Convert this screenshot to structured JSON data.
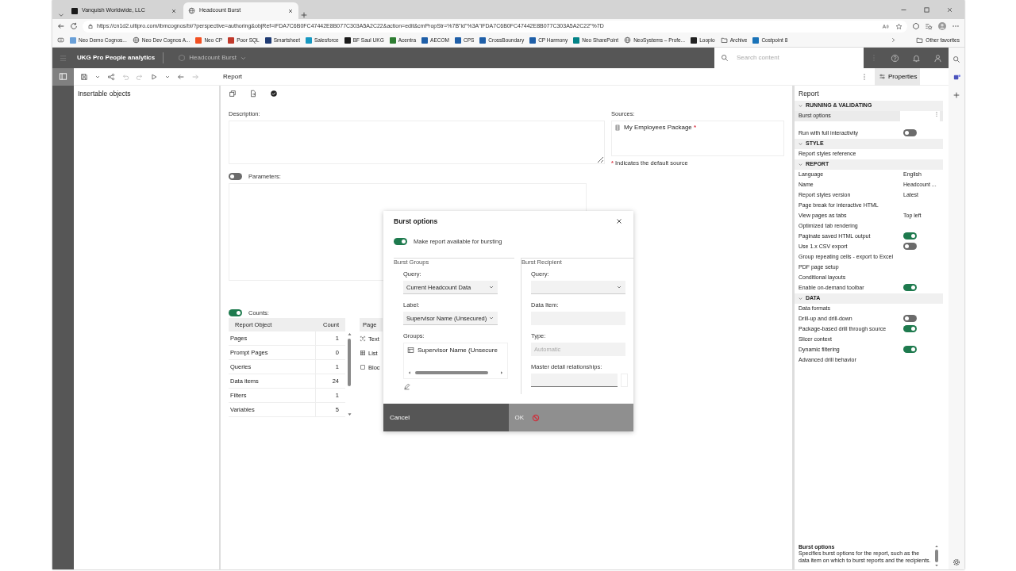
{
  "browser": {
    "tabs": [
      {
        "label": "Vanquish Worldwide, LLC",
        "kind": "tile",
        "color": "#1a1a1a",
        "selected": false
      },
      {
        "label": "Headcount Burst",
        "kind": "globe",
        "selected": true
      }
    ],
    "url": "https://cn1d2.ultipro.com/ibmcognos/bi/?perspective=authoring&objRef=iFDA7C6B0FC47442E8B077C303A5A2C22&action=edit&cmPropStr=%7B\"id\"%3A\"iFDA7C6B0FC47442E8B077C303A5A2C22\"%7D",
    "bookmarks": [
      {
        "label": "Neo Demo Cognos...",
        "kind": "tile",
        "color": "#6aa0d8"
      },
      {
        "label": "Neo Dev Cognos A...",
        "kind": "globe"
      },
      {
        "label": "Neo CP",
        "kind": "tile",
        "color": "#f25022"
      },
      {
        "label": "Poor SQL",
        "kind": "tile",
        "color": "#c0392b"
      },
      {
        "label": "Smartsheet",
        "kind": "tile",
        "color": "#1f3b73"
      },
      {
        "label": "Salesforce",
        "kind": "tile",
        "color": "#1798c1"
      },
      {
        "label": "BF Saul UKG",
        "kind": "tile",
        "color": "#1a1a1a"
      },
      {
        "label": "Acentra",
        "kind": "tile",
        "color": "#2e7d32"
      },
      {
        "label": "AECOM",
        "kind": "tile",
        "color": "#1f5fa8"
      },
      {
        "label": "CPS",
        "kind": "tile",
        "color": "#1f5fa8"
      },
      {
        "label": "CrossBoundary",
        "kind": "tile",
        "color": "#1f5fa8"
      },
      {
        "label": "CP Harmony",
        "kind": "tile",
        "color": "#1f5fa8"
      },
      {
        "label": "Neo SharePoint",
        "kind": "tile",
        "color": "#038387"
      },
      {
        "label": "NeoSystems – Profe...",
        "kind": "globe"
      },
      {
        "label": "Loopio",
        "kind": "tile",
        "color": "#222222"
      },
      {
        "label": "Archive",
        "kind": "folder"
      },
      {
        "label": "Costpoint 8",
        "kind": "tile",
        "color": "#1a73b8"
      }
    ],
    "other_favorites": "Other favorites"
  },
  "app": {
    "title": "UKG Pro People analytics",
    "report_name": "Headcount Burst",
    "search": {
      "placeholder": "Search content"
    }
  },
  "toolbar": {
    "breadcrumb": "Report",
    "properties_button": "Properties"
  },
  "insertable_objects": {
    "title": "Insertable objects"
  },
  "report_info": {
    "description_label": "Description:",
    "sources_label": "Sources:",
    "source": "My Employees Package",
    "source_mark": "*",
    "note_mark": "*",
    "note": "Indicates the default source",
    "parameters": {
      "label": "Parameters:",
      "on": false
    },
    "counts": {
      "label": "Counts:",
      "on": true,
      "columns": [
        "Report Object",
        "Count"
      ],
      "rows": [
        {
          "object": "Pages",
          "count": "1"
        },
        {
          "object": "Prompt Pages",
          "count": "0"
        },
        {
          "object": "Queries",
          "count": "1"
        },
        {
          "object": "Data items",
          "count": "24"
        },
        {
          "object": "Filters",
          "count": "1"
        },
        {
          "object": "Variables",
          "count": "5"
        }
      ]
    },
    "page_objects": {
      "columns": [
        "Page"
      ],
      "rows": [
        {
          "kind": "text",
          "label": "Text"
        },
        {
          "kind": "list",
          "label": "List"
        },
        {
          "kind": "block",
          "label": "Bloc"
        }
      ]
    }
  },
  "dialog": {
    "title": "Burst options",
    "enable": {
      "label": "Make report available for bursting",
      "on": true
    },
    "groups": {
      "legend": "Burst Groups",
      "query_label": "Query:",
      "query": "Current Headcount Data",
      "label_label": "Label:",
      "label": "Supervisor Name (Unsecured)",
      "groups_label": "Groups:",
      "groups": [
        {
          "label": "Supervisor Name (Unsecure"
        }
      ]
    },
    "recipient": {
      "legend": "Burst Recipient",
      "query_label": "Query:",
      "data_item_label": "Data Item:",
      "type_label": "Type:",
      "type": {
        "value": "Automatic",
        "disabled": true
      },
      "master_detail_label": "Master detail relationships:"
    },
    "buttons": [
      {
        "label": "Cancel",
        "disabled": false
      },
      {
        "label": "OK",
        "disabled": true
      }
    ]
  },
  "properties": {
    "title": "Report",
    "sections": [
      {
        "title": "RUNNING & VALIDATING",
        "expanded": true,
        "rows": [
          {
            "label": "Burst options",
            "kind": "action",
            "selected": true
          },
          {
            "label": "Run with full interactivity",
            "kind": "toggle",
            "on": false,
            "selected": false
          }
        ]
      },
      {
        "title": "STYLE",
        "expanded": true,
        "rows": [
          {
            "label": "Report styles reference",
            "kind": "plain",
            "selected": false
          }
        ]
      },
      {
        "title": "REPORT",
        "expanded": true,
        "rows": [
          {
            "label": "Language",
            "kind": "value",
            "value": "English",
            "selected": false
          },
          {
            "label": "Name",
            "kind": "value",
            "value": "Headcount ...",
            "selected": false
          },
          {
            "label": "Report styles version",
            "kind": "value",
            "value": "Latest",
            "selected": false
          },
          {
            "label": "Page break for interactive HTML",
            "kind": "plain",
            "selected": false
          },
          {
            "label": "View pages as tabs",
            "kind": "value",
            "value": "Top left",
            "selected": false
          },
          {
            "label": "Optimized tab rendering",
            "kind": "plain",
            "selected": false
          },
          {
            "label": "Paginate saved HTML output",
            "kind": "toggle",
            "on": true,
            "selected": false
          },
          {
            "label": "Use 1.x CSV export",
            "kind": "toggle",
            "on": false,
            "selected": false
          },
          {
            "label": "Group repeating cells - export to Excel",
            "kind": "plain",
            "selected": false
          },
          {
            "label": "PDF page setup",
            "kind": "plain",
            "selected": false
          },
          {
            "label": "Conditional layouts",
            "kind": "plain",
            "selected": false
          },
          {
            "label": "Enable on-demand toolbar",
            "kind": "toggle",
            "on": true,
            "selected": false
          }
        ]
      },
      {
        "title": "DATA",
        "expanded": true,
        "rows": [
          {
            "label": "Data formats",
            "kind": "plain",
            "selected": false
          },
          {
            "label": "Drill-up and drill-down",
            "kind": "toggle",
            "on": false,
            "selected": false
          },
          {
            "label": "Package-based drill through source",
            "kind": "toggle",
            "on": true,
            "selected": false
          },
          {
            "label": "Slicer context",
            "kind": "plain",
            "selected": false
          },
          {
            "label": "Dynamic filtering",
            "kind": "toggle",
            "on": true,
            "selected": false
          },
          {
            "label": "Advanced drill behavior",
            "kind": "plain",
            "selected": false
          }
        ]
      }
    ],
    "help": {
      "title": "Burst options",
      "text": "Specifies burst options for the report, such as the data item on which to burst reports and the recipients."
    }
  }
}
